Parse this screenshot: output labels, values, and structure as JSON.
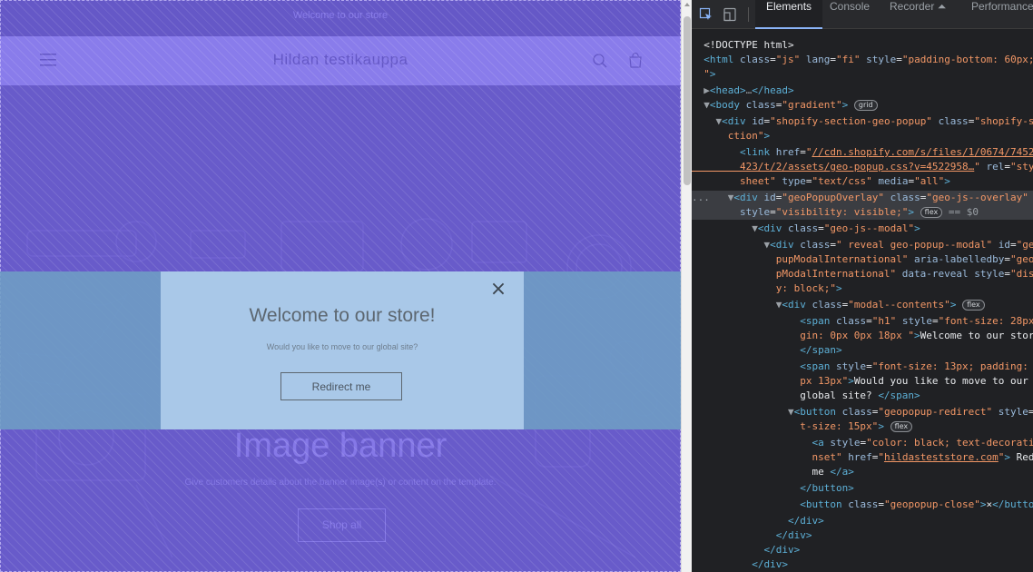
{
  "page": {
    "announcement": "Welcome to our store",
    "store_title": "Hildan testikauppa",
    "banner": {
      "heading": "Image banner",
      "text": "Give customers details about the banner image(s) or content on the template.",
      "button": "Shop all"
    }
  },
  "modal": {
    "title": "Welcome to our store!",
    "subtitle": "Would you like to move to our global site?",
    "redirect": "Redirect me",
    "close": "×"
  },
  "devtools": {
    "tabs": [
      "Elements",
      "Console",
      "Recorder ⏶",
      "Performance"
    ],
    "active_tab": "Elements",
    "selected_suffix": "== $0",
    "badges": {
      "grid": "grid",
      "flex": "flex"
    }
  },
  "colors": {
    "highlight": "#6f5fe6",
    "flex_strip": "#6e9ec4",
    "modal_bg": "#a9c8e8",
    "devtools_bg": "#202124"
  }
}
